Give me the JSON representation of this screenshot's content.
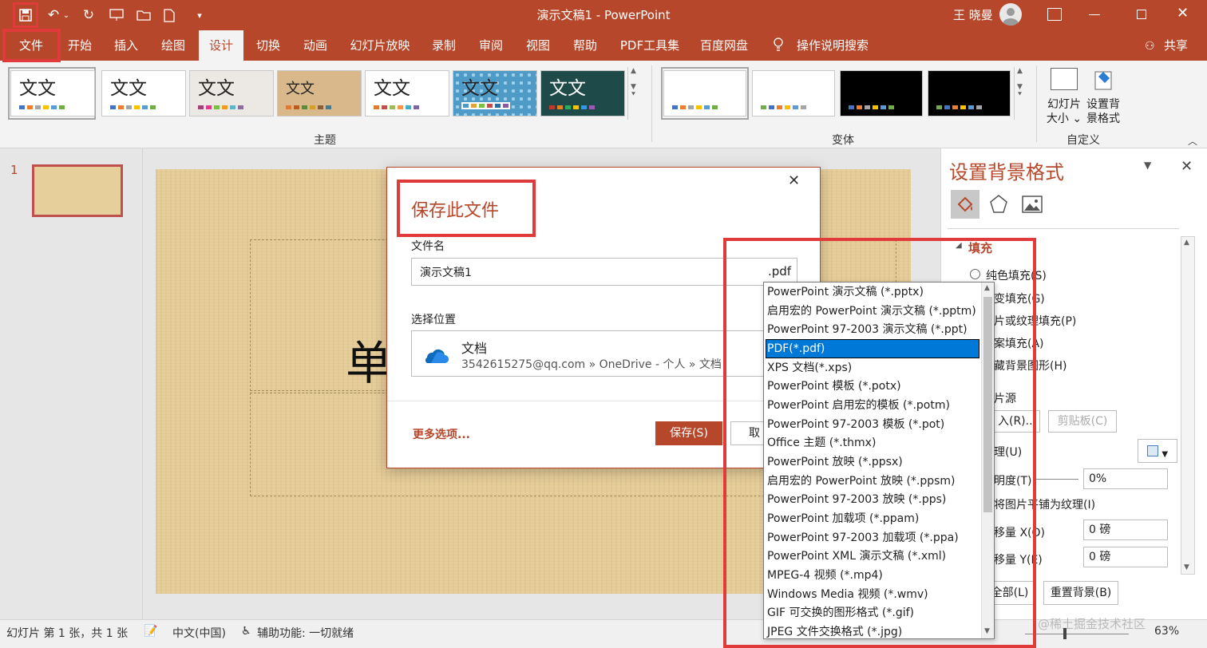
{
  "app": {
    "title": "演示文稿1 - PowerPoint",
    "user": "王 晓曼"
  },
  "quick_access": {
    "save": "save-icon",
    "undo": "undo-icon",
    "redo": "redo-icon"
  },
  "tabs": [
    "文件",
    "开始",
    "插入",
    "绘图",
    "设计",
    "切换",
    "动画",
    "幻灯片放映",
    "录制",
    "审阅",
    "视图",
    "帮助",
    "PDF工具集",
    "百度网盘"
  ],
  "tell_me": "操作说明搜索",
  "share": "共享",
  "ribbon": {
    "themes_label": "主题",
    "variants_label": "变体",
    "customize_label": "自定义",
    "theme_text": "文文",
    "slide_size": "幻灯片大小",
    "slide_size_arrow": "⌄",
    "format_bg": "设置背景格式"
  },
  "slide_panel": {
    "number": "1"
  },
  "slide": {
    "title_glyph": "单"
  },
  "dialog": {
    "title": "保存此文件",
    "filename_label": "文件名",
    "filename_value": "演示文稿1",
    "ext": ".pdf",
    "location_label": "选择位置",
    "location_name": "文档",
    "location_path": "3542615275@qq.com » OneDrive - 个人 » 文档",
    "more_options": "更多选项...",
    "save": "保存(S)",
    "cancel": "取"
  },
  "file_types": [
    "PowerPoint 演示文稿 (*.pptx)",
    "启用宏的 PowerPoint 演示文稿 (*.pptm)",
    "PowerPoint 97-2003 演示文稿 (*.ppt)",
    "PDF(*.pdf)",
    "XPS 文档(*.xps)",
    "PowerPoint 模板 (*.potx)",
    "PowerPoint 启用宏的模板 (*.potm)",
    "PowerPoint 97-2003 模板 (*.pot)",
    "Office 主题 (*.thmx)",
    "PowerPoint 放映 (*.ppsx)",
    "启用宏的 PowerPoint 放映 (*.ppsm)",
    "PowerPoint 97-2003 放映 (*.pps)",
    "PowerPoint 加载项 (*.ppam)",
    "PowerPoint 97-2003 加载项 (*.ppa)",
    "PowerPoint XML 演示文稿 (*.xml)",
    "MPEG-4 视频 (*.mp4)",
    "Windows Media 视频 (*.wmv)",
    "GIF 可交换的图形格式 (*.gif)",
    "JPEG 文件交换格式 (*.jpg)"
  ],
  "selected_file_type": "PDF(*.pdf)",
  "format_pane": {
    "title": "设置背景格式",
    "section_fill": "填充",
    "solid": "纯色填充(S)",
    "gradient": "变填充(G)",
    "picture": "片或纹理填充(P)",
    "pattern": "案填充(A)",
    "hide_bg": "藏背景图形(H)",
    "source": "片源",
    "insert": "入(R)...",
    "clipboard": "剪贴板(C)",
    "texture": "理(U)",
    "transparency": "明度(T)",
    "transparency_value": "0%",
    "tile": "将图片平铺为纹理(I)",
    "offset_x": "移量 X(O)",
    "offset_x_value": "0 磅",
    "offset_y": "移量 Y(E)",
    "offset_y_value": "0 磅",
    "apply_all": "全部(L)",
    "reset": "重置背景(B)"
  },
  "status": {
    "slide_info": "幻灯片 第 1 张，共 1 张",
    "language": "中文(中国)",
    "accessibility": "辅助功能: 一切就绪",
    "zoom": "63%",
    "watermark": "@稀土掘金技术社区"
  },
  "colors": {
    "accent": "#b7472a",
    "highlight": "#e03a3a",
    "selection": "#0078d7"
  }
}
